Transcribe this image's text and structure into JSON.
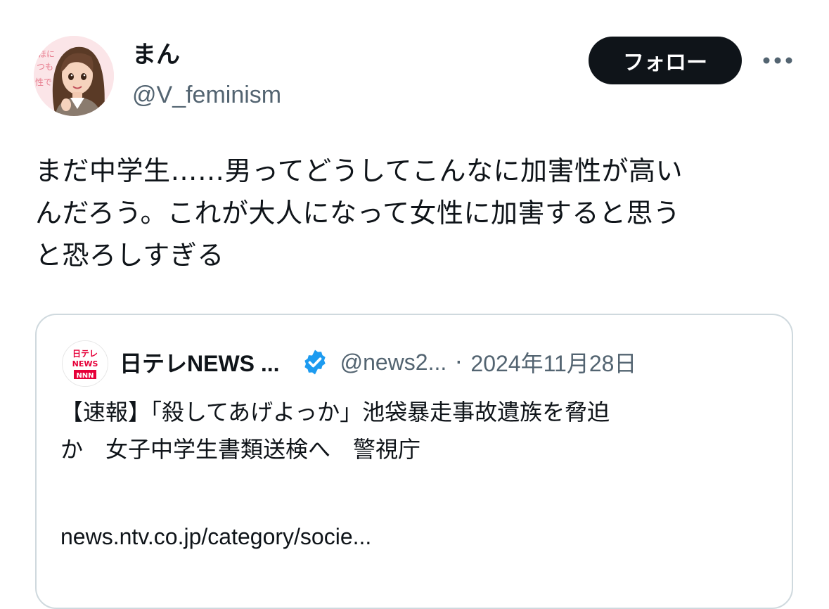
{
  "author": {
    "display_name": "まん",
    "handle": "@V_feminism",
    "avatar_icon": "illustrated-woman-avatar",
    "avatar_text_lines": [
      "ほに",
      "つも",
      "性で"
    ]
  },
  "actions": {
    "follow_label": "フォロー",
    "more_icon": "more-dots-icon"
  },
  "tweet": {
    "text": "まだ中学生……男ってどうしてこんなに加害性が高い\nんだろう。これが大人になって女性に加害すると思う\nと恐ろしすぎる"
  },
  "quoted": {
    "source_logo_text": [
      "日テレ",
      "NEWS",
      "NNN"
    ],
    "name": "日テレNEWS ...",
    "verified_icon": "verified-badge-icon",
    "handle": "@news2...",
    "separator": "·",
    "date": "2024年11月28日",
    "text": "【速報】「殺してあげよっか」池袋暴走事故遺族を脅迫\nか　女子中学生書類送検へ　警視庁",
    "link": "news.ntv.co.jp/category/socie..."
  },
  "colors": {
    "text_primary": "#0f1419",
    "text_secondary": "#536471",
    "follow_bg": "#0f1419",
    "border": "#cfd9de",
    "verified": "#1d9bf0",
    "logo_red": "#e60039"
  }
}
